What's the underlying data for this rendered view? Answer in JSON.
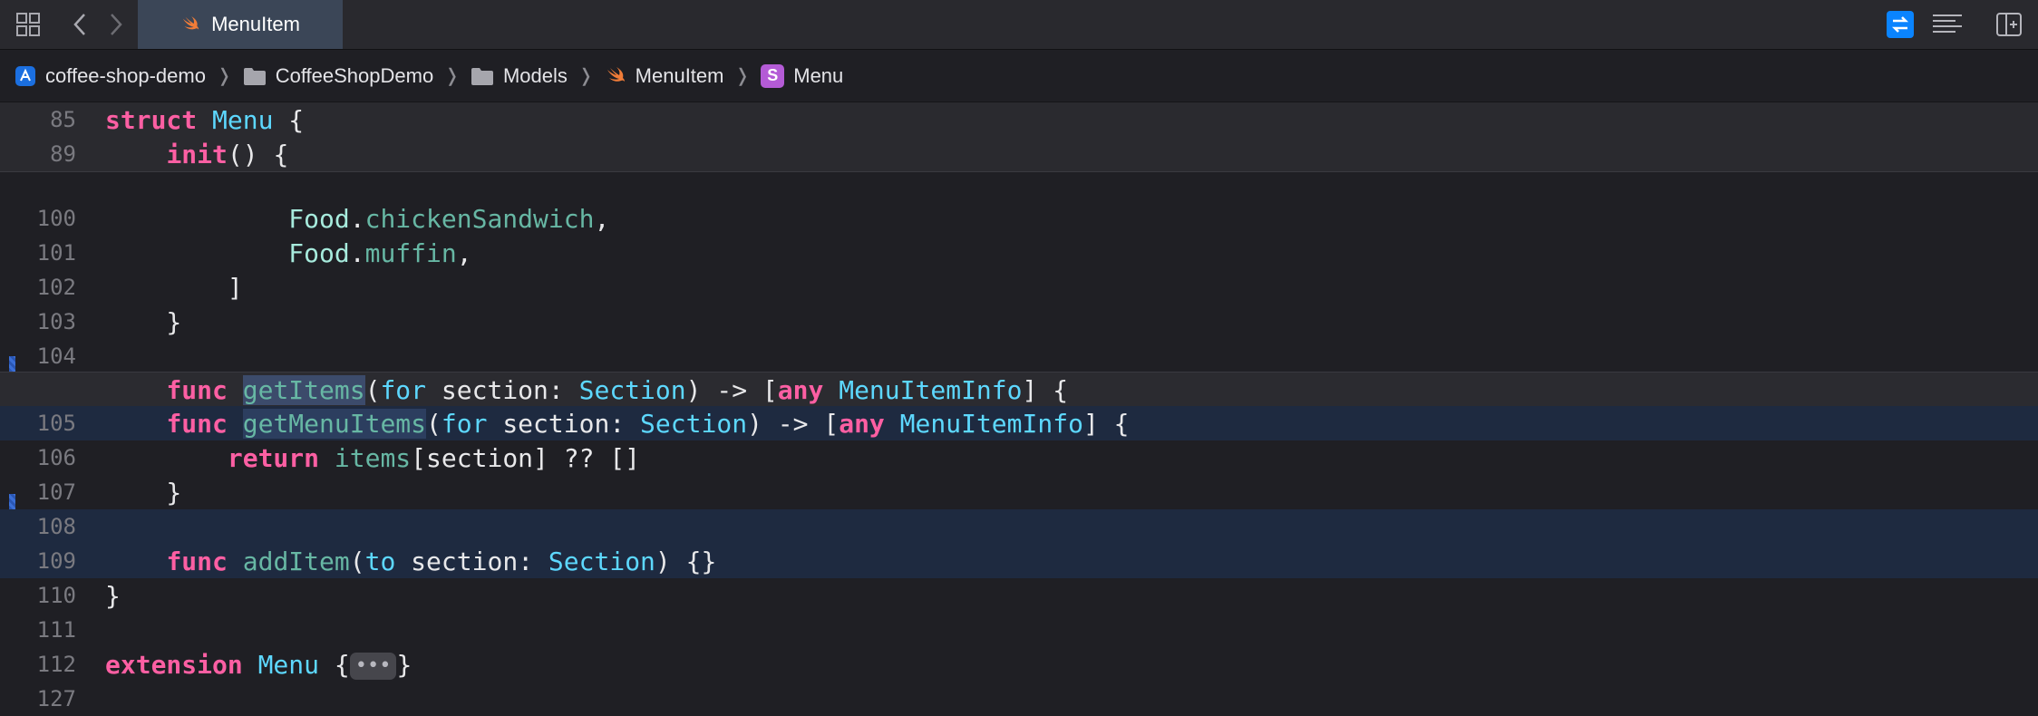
{
  "tab": {
    "title": "MenuItem"
  },
  "breadcrumb": [
    {
      "label": "coffee-shop-demo",
      "icon": "app-icon"
    },
    {
      "label": "CoffeeShopDemo",
      "icon": "folder-icon"
    },
    {
      "label": "Models",
      "icon": "folder-icon"
    },
    {
      "label": "MenuItem",
      "icon": "swift-icon"
    },
    {
      "label": "Menu",
      "icon": "struct-icon",
      "badge": "S"
    }
  ],
  "colors": {
    "accent": "#0a84ff",
    "keyword": "#fc5fa3",
    "type": "#5dd8ff",
    "function": "#67b7a4",
    "change_bar": "#3b6fd6"
  },
  "lines": {
    "l85": {
      "num": "85"
    },
    "l89": {
      "num": "89"
    },
    "l100": {
      "num": "100"
    },
    "l101": {
      "num": "101"
    },
    "l102": {
      "num": "102"
    },
    "l103": {
      "num": "103"
    },
    "l104": {
      "num": "104"
    },
    "l105": {
      "num": "105"
    },
    "l106": {
      "num": "106"
    },
    "l107": {
      "num": "107"
    },
    "l108": {
      "num": "108"
    },
    "l109": {
      "num": "109"
    },
    "l110": {
      "num": "110"
    },
    "l111": {
      "num": "111"
    },
    "l112": {
      "num": "112"
    },
    "l127": {
      "num": "127"
    }
  },
  "code": {
    "struct_kw": "struct",
    "menu_type": "Menu",
    "brace_open": " {",
    "init_kw": "init",
    "init_rest": "() {",
    "food": "Food",
    "chicken": "chickenSandwich",
    "muffin": "muffin",
    "func_kw": "func",
    "getItems": "getItems",
    "getMenuItems": "getMenuItems",
    "for_kw": "for",
    "section_param": " section: ",
    "section_type": "Section",
    "arrow": ") -> [",
    "any_kw": "any",
    "menuiteminfo": "MenuItemInfo",
    "return_kw": "return",
    "items": "items",
    "return_rest": "[section] ?? []",
    "addItem": "addItem",
    "to_kw": "to",
    "add_rest": ") {}",
    "extension_kw": "extension",
    "fold": "•••"
  }
}
